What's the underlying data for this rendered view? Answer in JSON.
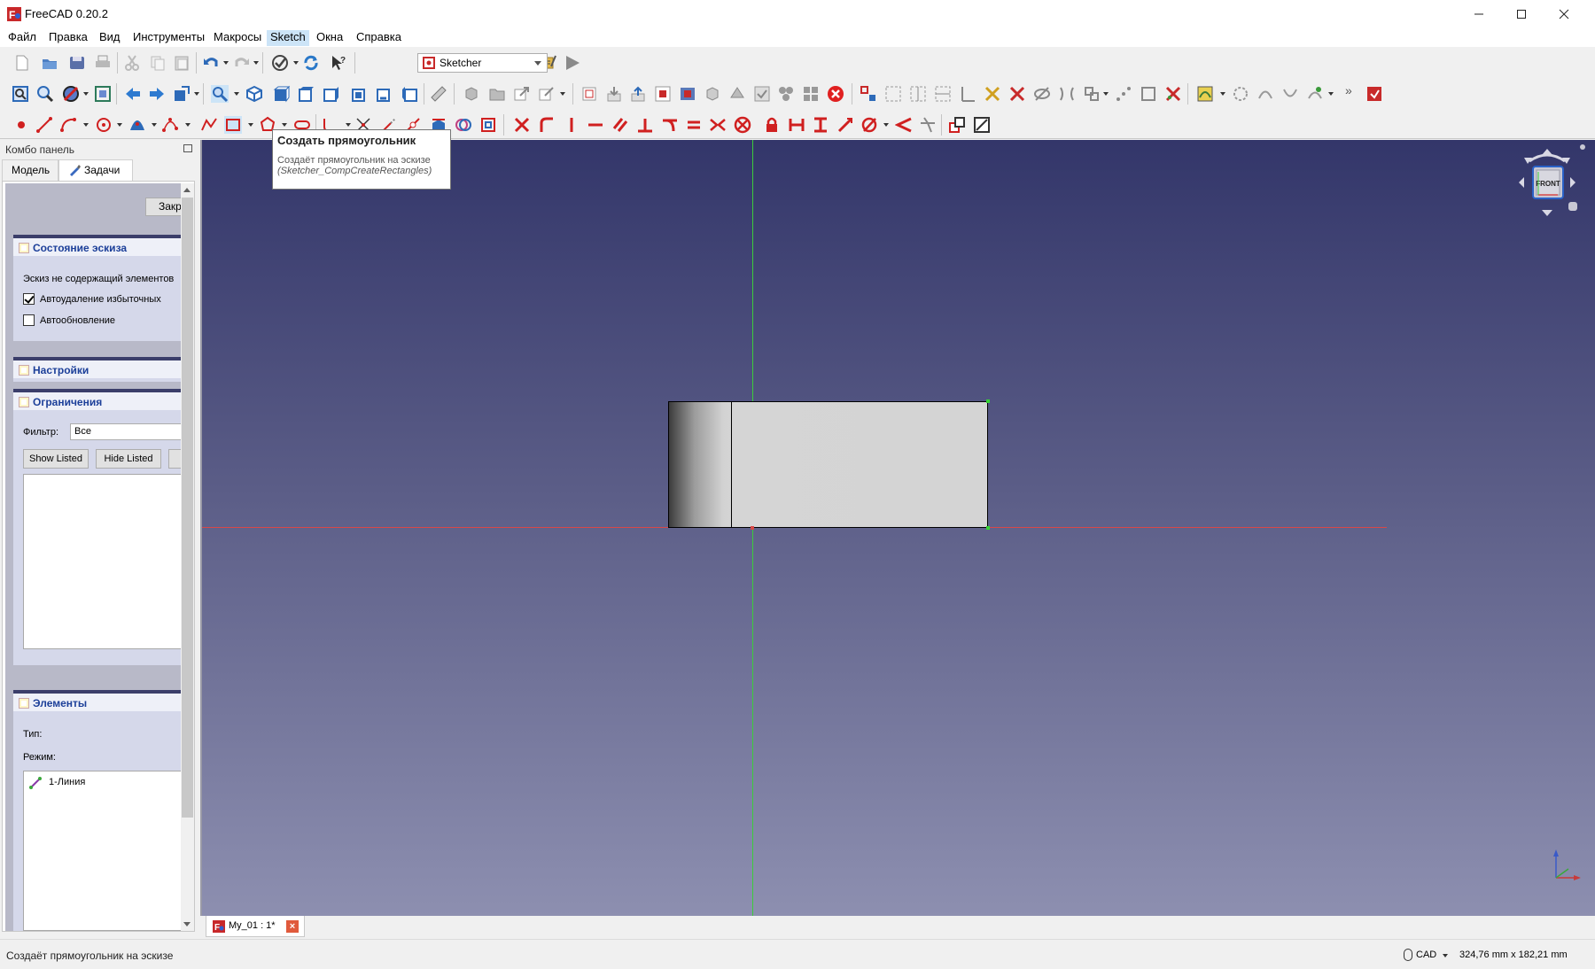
{
  "window": {
    "title": "FreeCAD 0.20.2"
  },
  "menu": [
    "Файл",
    "Правка",
    "Вид",
    "Инструменты",
    "Макросы",
    "Sketch",
    "Окна",
    "Справка"
  ],
  "menu_active": "Sketch",
  "workbench": {
    "selected": "Sketcher"
  },
  "tooltip": {
    "title": "Создать прямоугольник",
    "description": "Создаёт прямоугольник на эскизе",
    "command": "(Sketcher_CompCreateRectangles)"
  },
  "combo": {
    "title": "Комбо панель",
    "tabs": {
      "model": "Модель",
      "tasks": "Задачи"
    },
    "close_button": "Закрыть",
    "sketch_state": {
      "header": "Состояние эскиза",
      "message": "Эскиз не содержащий элементов",
      "auto_remove": "Автоудаление избыточных",
      "auto_remove_checked": true,
      "auto_update": "Автообновление",
      "auto_update_checked": false
    },
    "settings": {
      "header": "Настройки"
    },
    "constraints": {
      "header": "Ограничения",
      "filter_label": "Фильтр:",
      "filter_value": "Все",
      "show_listed": "Show Listed",
      "hide_listed": "Hide Listed"
    },
    "elements": {
      "header": "Элементы",
      "type_label": "Тип:",
      "mode_label": "Режим:",
      "items": [
        "1-Линия"
      ]
    }
  },
  "document_tab": {
    "label": "My_01 : 1*",
    "close": "×"
  },
  "navcube": {
    "face": "FRONT"
  },
  "status": {
    "message": "Создаёт прямоугольник на эскизе",
    "nav_style": "CAD",
    "dimensions": "324,76 mm x 182,21 mm"
  },
  "colors": {
    "accent_header": "#1c3f99",
    "axis_x": "#d84848",
    "axis_y": "#3ccc3c",
    "record_button": "#e02020"
  }
}
